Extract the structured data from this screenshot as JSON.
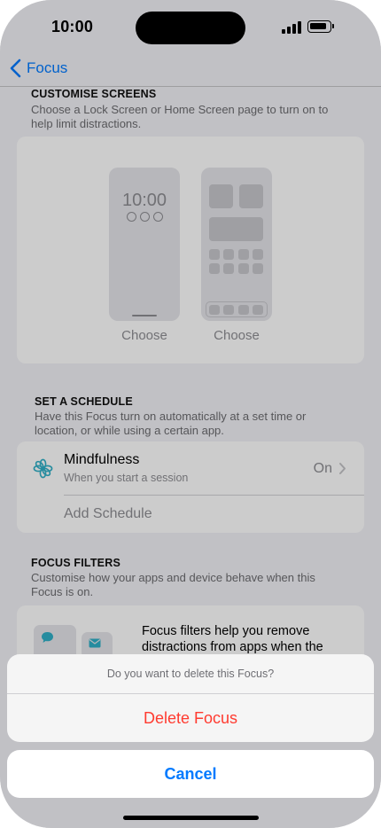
{
  "status_bar": {
    "time": "10:00"
  },
  "nav": {
    "back_label": "Focus"
  },
  "customise": {
    "header": "CUSTOMISE SCREENS",
    "description": "Choose a Lock Screen or Home Screen page to turn on to help limit distractions.",
    "lock_mock_time": "10:00",
    "lock_choose": "Choose",
    "home_choose": "Choose"
  },
  "schedule": {
    "header": "SET A SCHEDULE",
    "description": "Have this Focus turn on automatically at a set time or location, or while using a certain app.",
    "item_title": "Mindfulness",
    "item_subtitle": "When you start a session",
    "item_value": "On",
    "add_label": "Add Schedule"
  },
  "filters": {
    "header": "FOCUS FILTERS",
    "description": "Customise how your apps and device behave when this Focus is on.",
    "card_text": "Focus filters help you remove distractions from apps when the"
  },
  "action_sheet": {
    "message": "Do you want to delete this Focus?",
    "delete_label": "Delete Focus",
    "cancel_label": "Cancel"
  },
  "colors": {
    "accent": "#007aff",
    "destructive": "#ff3b30",
    "mindfulness": "#30b0c7"
  }
}
